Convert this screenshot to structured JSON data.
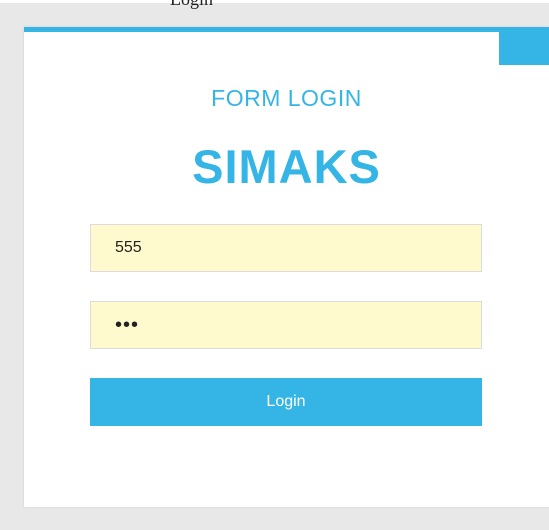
{
  "top_caption": "Login",
  "form": {
    "subtitle": "FORM LOGIN",
    "title": "SIMAKS",
    "username_value": "555",
    "password_value": "555",
    "login_label": "Login"
  },
  "colors": {
    "accent": "#35b5e5",
    "page_background": "#e8e8e8",
    "input_background": "#fffacd"
  }
}
